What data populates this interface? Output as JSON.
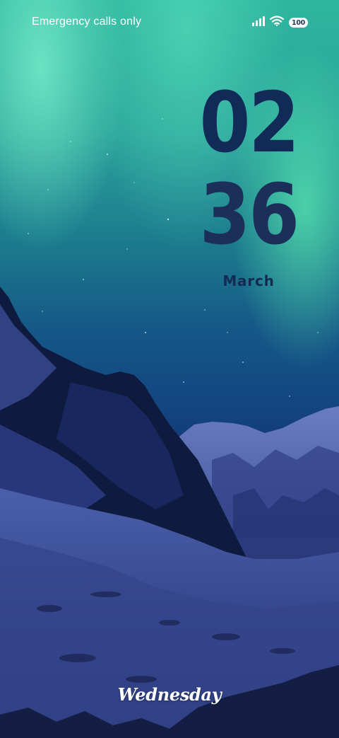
{
  "status_bar": {
    "carrier_text": "Emergency calls only",
    "battery_level": "100",
    "icons": [
      "signal-icon",
      "wifi-icon",
      "battery-icon"
    ]
  },
  "lock_screen": {
    "hour": "02",
    "minute": "36",
    "month": "March",
    "weekday": "Wednesday"
  },
  "wallpaper": {
    "subject": "aurora-over-snowy-mountains",
    "colors": {
      "aurora": "#3fe0b0",
      "sky_top": "#2aa39a",
      "sky_deep": "#123a78",
      "snow": "#3a4d9a",
      "rock": "#0d1838"
    }
  },
  "colors": {
    "clock": "#112a58",
    "status_text": "#ffffff"
  }
}
